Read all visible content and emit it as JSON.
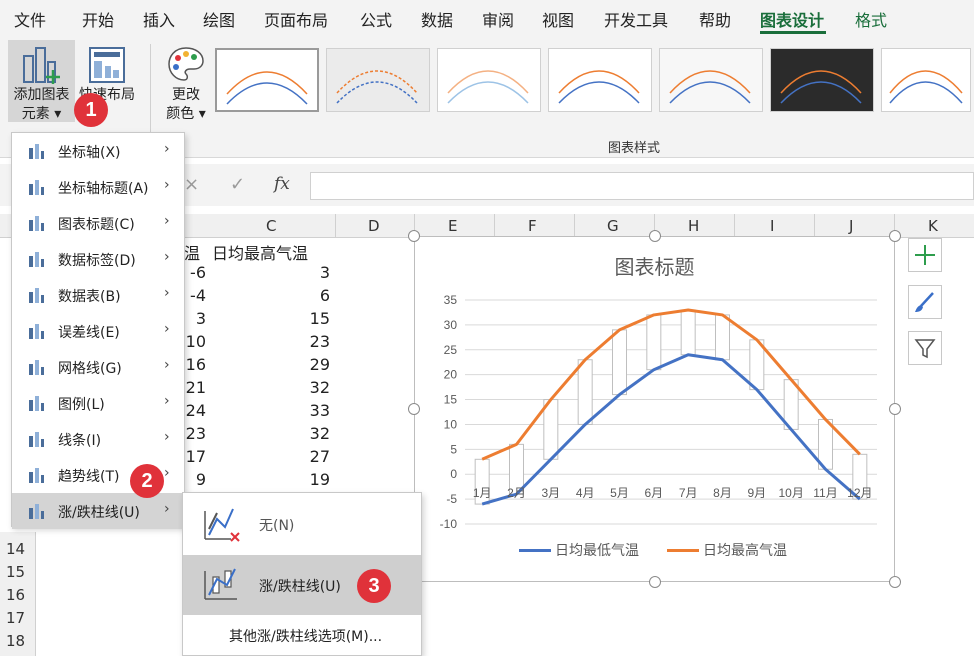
{
  "menubar": {
    "tabs": [
      {
        "label": "文件"
      },
      {
        "label": "开始"
      },
      {
        "label": "插入"
      },
      {
        "label": "绘图"
      },
      {
        "label": "页面布局"
      },
      {
        "label": "公式"
      },
      {
        "label": "数据"
      },
      {
        "label": "审阅"
      },
      {
        "label": "视图"
      },
      {
        "label": "开发工具"
      },
      {
        "label": "帮助"
      },
      {
        "label": "图表设计"
      },
      {
        "label": "格式"
      }
    ],
    "active_tab": "图表设计"
  },
  "ribbon": {
    "add_element_label_1": "添加图表",
    "add_element_label_2": "元素 ▾",
    "quick_layout_label_1": "快速布局",
    "quick_layout_label_2": "",
    "change_colors_label_1": "更改",
    "change_colors_label_2": "颜色 ▾",
    "group_label": "图表样式"
  },
  "formula_bar": {
    "cancel_icon": "×",
    "enter_icon": "✓",
    "fx_label": "fx"
  },
  "columns": [
    "C",
    "D",
    "E",
    "F",
    "G",
    "H",
    "I",
    "J",
    "K"
  ],
  "rows": [
    "14",
    "15",
    "16",
    "17",
    "18"
  ],
  "table": {
    "header_b": "温",
    "header_c": "日均最高气温",
    "low": [
      "-6",
      "-4",
      "3",
      "10",
      "16",
      "21",
      "24",
      "23",
      "17",
      "9"
    ],
    "high": [
      "3",
      "6",
      "15",
      "23",
      "29",
      "32",
      "33",
      "32",
      "27",
      "19"
    ]
  },
  "chart": {
    "title": "图表标题",
    "legend_low": "日均最低气温",
    "legend_high": "日均最高气温",
    "colors": {
      "low": "#4472c4",
      "high": "#ed7d31"
    }
  },
  "chart_data": {
    "type": "line",
    "title": "图表标题",
    "categories": [
      "1月",
      "2月",
      "3月",
      "4月",
      "5月",
      "6月",
      "7月",
      "8月",
      "9月",
      "10月",
      "11月",
      "12月"
    ],
    "series": [
      {
        "name": "日均最低气温",
        "values": [
          -6,
          -4,
          3,
          10,
          16,
          21,
          24,
          23,
          17,
          9,
          1,
          -5
        ]
      },
      {
        "name": "日均最高气温",
        "values": [
          3,
          6,
          15,
          23,
          29,
          32,
          33,
          32,
          27,
          19,
          11,
          4
        ]
      }
    ],
    "ylim": [
      -10,
      35
    ],
    "yticks": [
      "35",
      "30",
      "25",
      "20",
      "15",
      "10",
      "5",
      "0",
      "-5",
      "-10"
    ],
    "up_down_bars": true,
    "legend": "bottom"
  },
  "dropdown": {
    "items": [
      {
        "label": "坐标轴(X)"
      },
      {
        "label": "坐标轴标题(A)"
      },
      {
        "label": "图表标题(C)"
      },
      {
        "label": "数据标签(D)"
      },
      {
        "label": "数据表(B)"
      },
      {
        "label": "误差线(E)"
      },
      {
        "label": "网格线(G)"
      },
      {
        "label": "图例(L)"
      },
      {
        "label": "线条(I)"
      },
      {
        "label": "趋势线(T)"
      },
      {
        "label": "涨/跌柱线(U)"
      }
    ]
  },
  "submenu": {
    "none_label": "无(N)",
    "updown_label": "涨/跌柱线(U)",
    "more_label": "其他涨/跌柱线选项(M)..."
  },
  "badges": [
    "1",
    "2",
    "3"
  ]
}
